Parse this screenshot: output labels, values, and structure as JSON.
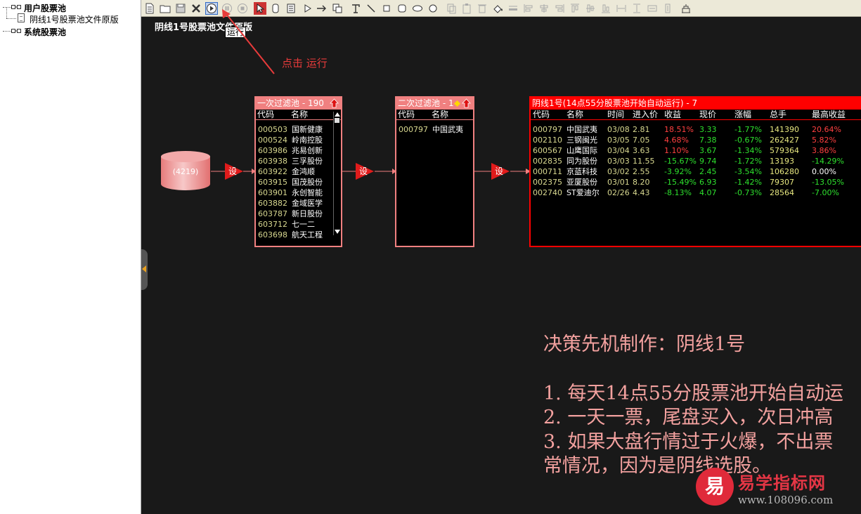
{
  "tree": {
    "user_pool": "用户股票池",
    "user_pool_child": "阴线1号股票池文件原版",
    "system_pool": "系统股票池"
  },
  "toolbar": {
    "run_tooltip": "运行",
    "icons": [
      "new-doc-icon",
      "open-folder-icon",
      "save-icon",
      "close-x-icon",
      "run-icon",
      "pause-icon",
      "stop-icon",
      "pointer-icon",
      "rounded-rect-icon",
      "list-icon",
      "triangle-icon",
      "arrow-icon",
      "copy-window-icon",
      "text-icon",
      "line-icon",
      "square-icon",
      "rounded-square-icon",
      "ellipse-icon",
      "circle-icon",
      "copy-icon",
      "paste-icon",
      "delete-icon",
      "fill-icon",
      "line-style-icon",
      "align-left-icon",
      "align-center-icon",
      "align-right-icon",
      "align-top-icon",
      "align-middle-icon",
      "align-bottom-icon",
      "same-width-icon",
      "same-height-icon",
      "grid-icon"
    ]
  },
  "canvas": {
    "title": "阴线1号股票池文件原版",
    "annotation": "点击 运行",
    "source_count": "(4219)",
    "set_label": "设"
  },
  "pool1": {
    "header": "一次过滤池 - 190",
    "col_code": "代码",
    "col_name": "名称",
    "rows": [
      {
        "code": "000503",
        "name": "国新健康"
      },
      {
        "code": "000524",
        "name": "岭南控股"
      },
      {
        "code": "603986",
        "name": "兆易创新"
      },
      {
        "code": "603938",
        "name": "三孚股份"
      },
      {
        "code": "603922",
        "name": "金鸿顺"
      },
      {
        "code": "603915",
        "name": "国茂股份"
      },
      {
        "code": "603901",
        "name": "永创智能"
      },
      {
        "code": "603882",
        "name": "金域医学"
      },
      {
        "code": "603787",
        "name": "新日股份"
      },
      {
        "code": "603712",
        "name": "七一二"
      },
      {
        "code": "603698",
        "name": "航天工程"
      }
    ]
  },
  "pool2": {
    "header": "二次过滤池 - 1",
    "col_code": "代码",
    "col_name": "名称",
    "rows": [
      {
        "code": "000797",
        "name": "中国武夷"
      }
    ]
  },
  "pool3": {
    "header": "阴线1号(14点55分股票池开始自动运行) - 7",
    "columns": [
      "代码",
      "名称",
      "时间",
      "进入价",
      "收益",
      "现价",
      "涨幅",
      "总手",
      "最高收益"
    ],
    "rows": [
      {
        "code": "000797",
        "name": "中国武夷",
        "time": "03/08",
        "entry": "2.81",
        "gain": "18.51%",
        "price": "3.33",
        "change": "-1.77%",
        "volume": "141390",
        "max_gain": "20.64%",
        "gain_color": "red",
        "max_color": "red"
      },
      {
        "code": "002110",
        "name": "三钢闽光",
        "time": "03/05",
        "entry": "7.05",
        "gain": "4.68%",
        "price": "7.38",
        "change": "-0.67%",
        "volume": "262427",
        "max_gain": "5.82%",
        "gain_color": "red",
        "max_color": "red"
      },
      {
        "code": "600567",
        "name": "山鹰国际",
        "time": "03/04",
        "entry": "3.63",
        "gain": "1.10%",
        "price": "3.67",
        "change": "-1.34%",
        "volume": "579364",
        "max_gain": "3.86%",
        "gain_color": "red",
        "max_color": "red"
      },
      {
        "code": "002835",
        "name": "同为股份",
        "time": "03/03",
        "entry": "11.55",
        "gain": "-15.67%",
        "price": "9.74",
        "change": "-1.72%",
        "volume": "13193",
        "max_gain": "-14.29%",
        "gain_color": "green",
        "max_color": "green"
      },
      {
        "code": "000711",
        "name": "京蓝科技",
        "time": "03/02",
        "entry": "2.55",
        "gain": "-3.92%",
        "price": "2.45",
        "change": "-3.54%",
        "volume": "106280",
        "max_gain": "0.00%",
        "gain_color": "green",
        "max_color": "white"
      },
      {
        "code": "002375",
        "name": "亚厦股份",
        "time": "03/01",
        "entry": "8.20",
        "gain": "-15.49%",
        "price": "6.93",
        "change": "-1.42%",
        "volume": "79307",
        "max_gain": "-13.05%",
        "gain_color": "green",
        "max_color": "green"
      },
      {
        "code": "002740",
        "name": "ST爱迪尔",
        "time": "02/26",
        "entry": "4.43",
        "gain": "-8.13%",
        "price": "4.07",
        "change": "-0.73%",
        "volume": "28564",
        "max_gain": "-7.00%",
        "gain_color": "green",
        "max_color": "green"
      }
    ]
  },
  "description": {
    "heading": "决策先机制作：阴线1号",
    "line1": "1. 每天14点55分股票池开始自动运",
    "line2": "2. 一天一票，尾盘买入，次日冲高",
    "line3": "3. 如果大盘行情过于火爆，不出票",
    "line4": "常情况，因为是阴线选股。"
  },
  "watermark": {
    "badge": "易",
    "title": "易学指标网",
    "url": "www.108096.com"
  },
  "colors": {
    "canvas_bg": "#191919",
    "pool_border": "#f08080",
    "pool3_border": "#ff0000",
    "accent_red": "#e02a3a",
    "gain_red": "#ff4040",
    "gain_green": "#2ee12e",
    "desc_text": "#f3a19f"
  }
}
